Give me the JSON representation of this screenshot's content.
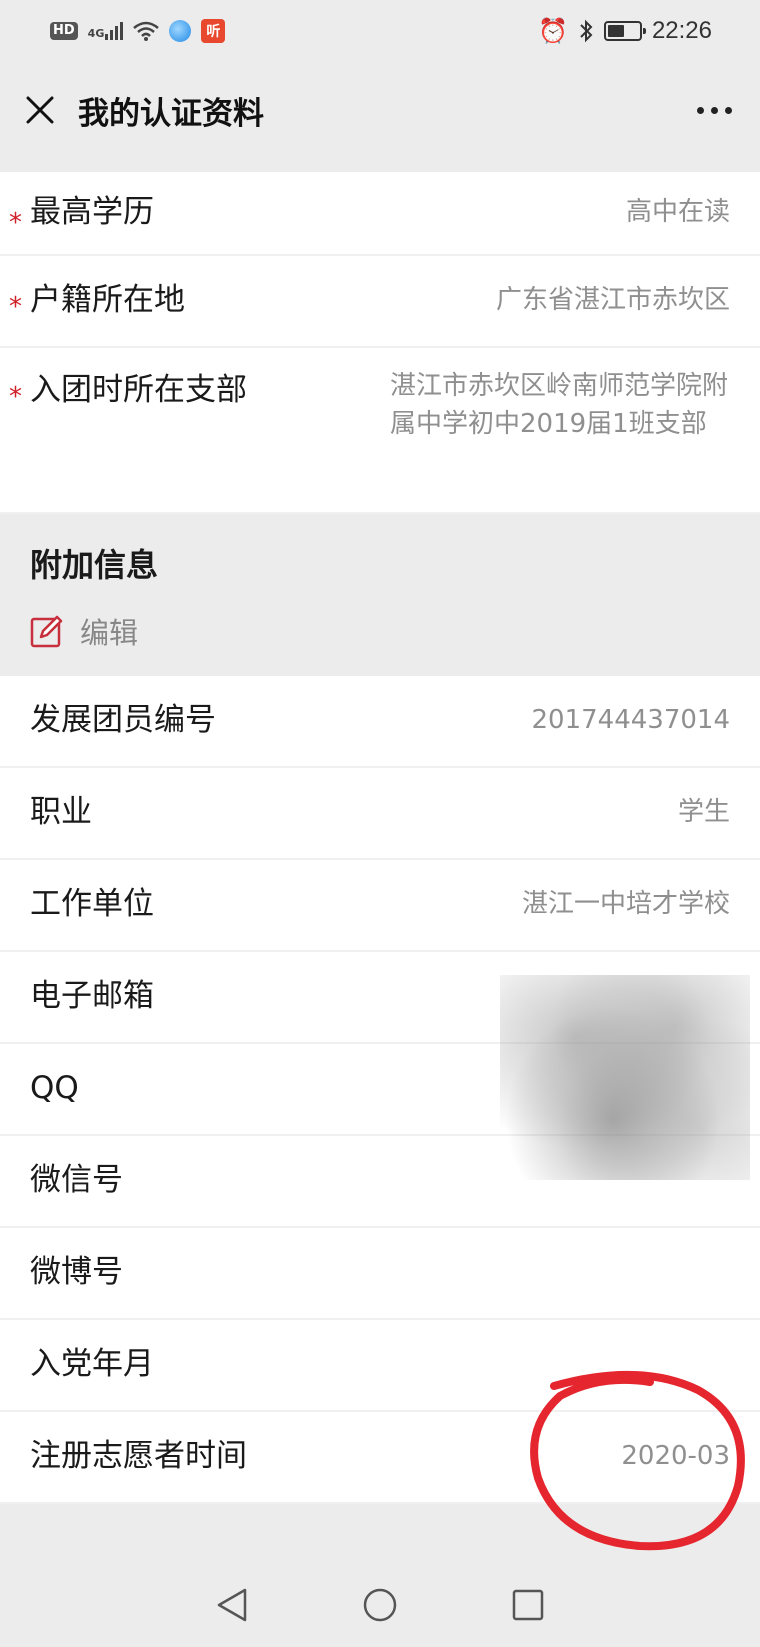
{
  "status_bar": {
    "hd": "HD",
    "network": "4G",
    "ting_icon": "听",
    "time": "22:26"
  },
  "header": {
    "title": "我的认证资料",
    "close_icon": "close-icon",
    "more_icon": "more-icon"
  },
  "required_rows": [
    {
      "label": "最高学历",
      "value": "高中在读"
    },
    {
      "label": "户籍所在地",
      "value": "广东省湛江市赤坎区"
    },
    {
      "label": "入团时所在支部",
      "value": "湛江市赤坎区岭南师范学院附属中学初中2019届1班支部"
    }
  ],
  "extra_section": {
    "title": "附加信息",
    "edit_label": "编辑"
  },
  "extra_rows": [
    {
      "label": "发展团员编号",
      "value": "201744437014"
    },
    {
      "label": "职业",
      "value": "学生"
    },
    {
      "label": "工作单位",
      "value": "湛江一中培才学校"
    },
    {
      "label": "电子邮箱",
      "value": ""
    },
    {
      "label": "QQ",
      "value": ""
    },
    {
      "label": "微信号",
      "value": ""
    },
    {
      "label": "微博号",
      "value": ""
    },
    {
      "label": "入党年月",
      "value": ""
    },
    {
      "label": "注册志愿者时间",
      "value": "2020-03"
    }
  ],
  "colors": {
    "required": "#d0202a",
    "edit_icon": "#c62f3b",
    "annotation": "#e5262e"
  }
}
